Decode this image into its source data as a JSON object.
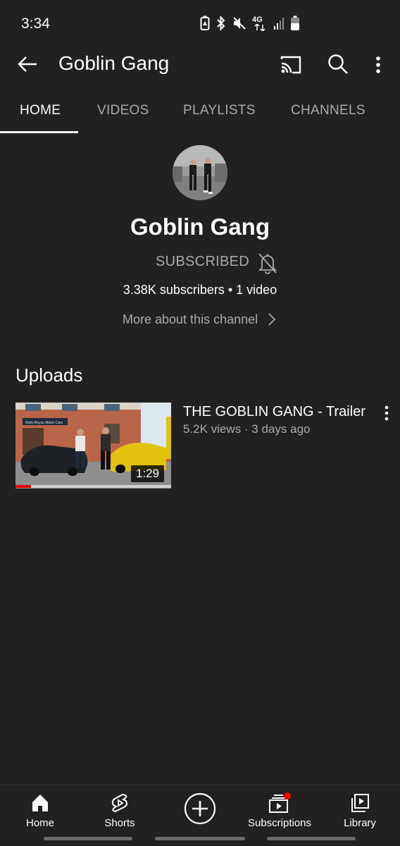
{
  "status_bar": {
    "time": "3:34",
    "icons": [
      "battery-saver-icon",
      "bluetooth-icon",
      "mute-icon",
      "lte-icon",
      "signal-icon",
      "battery-icon"
    ],
    "network_label": "4G"
  },
  "app_bar": {
    "title": "Goblin Gang",
    "icons": [
      "back-arrow-icon",
      "cast-icon",
      "search-icon",
      "more-vert-icon"
    ]
  },
  "tabs": [
    {
      "label": "HOME",
      "active": true
    },
    {
      "label": "VIDEOS",
      "active": false
    },
    {
      "label": "PLAYLISTS",
      "active": false
    },
    {
      "label": "CHANNELS",
      "active": false
    }
  ],
  "channel": {
    "name": "Goblin Gang",
    "subscribe_label": "SUBSCRIBED",
    "stats": "3.38K subscribers • 1 video",
    "more_about": "More about this channel"
  },
  "uploads": {
    "section_title": "Uploads",
    "videos": [
      {
        "title": "THE GOBLIN GANG - Trailer",
        "meta": "5.2K views · 3 days ago",
        "duration": "1:29",
        "watched_fraction": 0.1,
        "thumbnail_sign": "Rolls-Royce Motor Cars"
      }
    ]
  },
  "bottom_nav": {
    "items": [
      {
        "label": "Home",
        "icon": "home-icon",
        "active": true
      },
      {
        "label": "Shorts",
        "icon": "shorts-icon",
        "active": false
      },
      {
        "label": "",
        "icon": "create-plus-icon",
        "active": false
      },
      {
        "label": "Subscriptions",
        "icon": "subscriptions-icon",
        "active": false
      },
      {
        "label": "Library",
        "icon": "library-icon",
        "active": false
      }
    ]
  },
  "colors": {
    "background": "#212121",
    "text_primary": "#ffffff",
    "text_secondary": "#aaaaaa",
    "notification_dot": "#ff0000",
    "progress": "#e50000"
  }
}
